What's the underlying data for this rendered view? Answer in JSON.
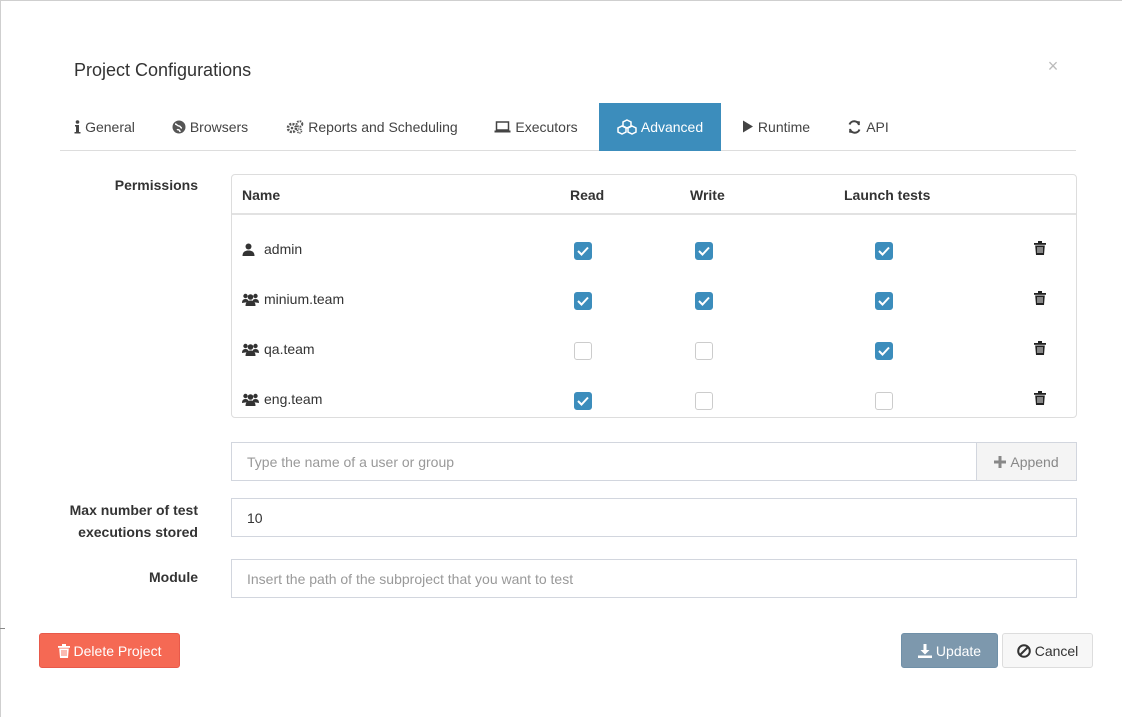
{
  "modal": {
    "title": "Project Configurations",
    "close_symbol": "×"
  },
  "tabs": [
    {
      "label": "General",
      "icon": "info-icon"
    },
    {
      "label": "Browsers",
      "icon": "globe-icon"
    },
    {
      "label": "Reports and Scheduling",
      "icon": "cogs-icon"
    },
    {
      "label": "Executors",
      "icon": "laptop-icon"
    },
    {
      "label": "Advanced",
      "icon": "cubes-icon",
      "active": true
    },
    {
      "label": "Runtime",
      "icon": "play-icon"
    },
    {
      "label": "API",
      "icon": "refresh-icon"
    }
  ],
  "permissions": {
    "label": "Permissions",
    "columns": [
      "Name",
      "Read",
      "Write",
      "Launch tests"
    ],
    "rows": [
      {
        "name": "admin",
        "type": "user",
        "read": true,
        "write": true,
        "launch": true
      },
      {
        "name": "minium.team",
        "type": "group",
        "read": true,
        "write": true,
        "launch": true
      },
      {
        "name": "qa.team",
        "type": "group",
        "read": false,
        "write": false,
        "launch": true
      },
      {
        "name": "eng.team",
        "type": "group",
        "read": true,
        "write": false,
        "launch": false
      }
    ],
    "append_placeholder": "Type the name of a user or group",
    "append_label": "Append"
  },
  "max_executions": {
    "label_line1": "Max number of test",
    "label_line2": "executions stored",
    "value": "10"
  },
  "module": {
    "label": "Module",
    "placeholder": "Insert the path of the subproject that you want to test"
  },
  "footer": {
    "delete_label": "Delete Project",
    "update_label": "Update",
    "cancel_label": "Cancel"
  },
  "colors": {
    "primary": "#3c8dbc",
    "danger": "#f56954",
    "update": "#7d98ad"
  }
}
